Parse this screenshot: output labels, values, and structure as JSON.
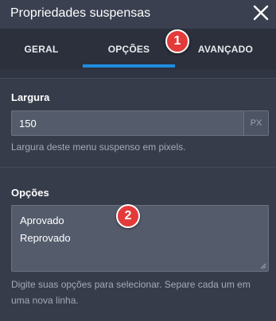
{
  "header": {
    "title": "Propriedades suspensas",
    "close_icon": "close-icon"
  },
  "tabs": [
    {
      "label": "GERAL",
      "active": false
    },
    {
      "label": "OPÇÕES",
      "active": true
    },
    {
      "label": "AVANÇADO",
      "active": false
    }
  ],
  "markers": {
    "first": "1",
    "second": "2"
  },
  "width_field": {
    "label": "Largura",
    "value": "150",
    "unit": "PX",
    "help": "Largura deste menu suspenso em pixels."
  },
  "options_field": {
    "label": "Opções",
    "lines": [
      "Aprovado",
      "Reprovado"
    ],
    "help": "Digite suas opções para selecionar. Separe cada um em uma nova linha."
  },
  "colors": {
    "accent": "#1f8de0",
    "marker": "#e33a3a",
    "panel": "#2f3542"
  }
}
